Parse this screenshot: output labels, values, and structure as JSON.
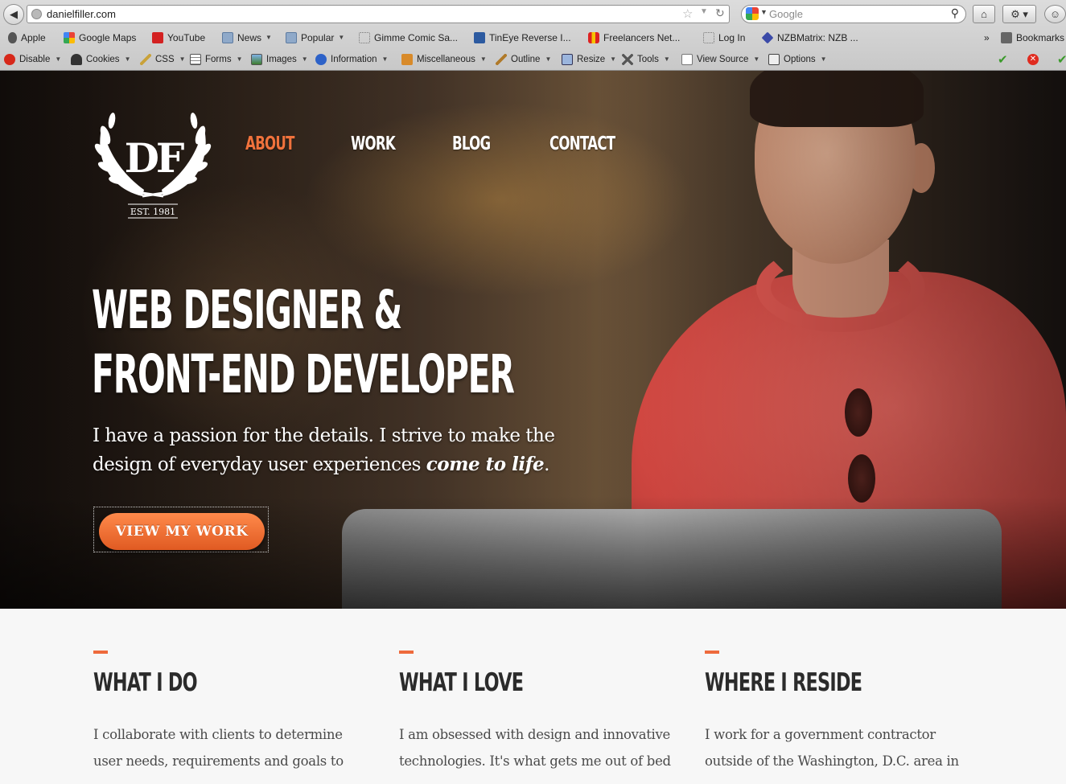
{
  "browser": {
    "url": "danielfiller.com",
    "search_placeholder": "Google",
    "bookmarks": [
      {
        "label": "Apple",
        "icon": "apple-icon"
      },
      {
        "label": "Google Maps",
        "icon": "google-icon"
      },
      {
        "label": "YouTube",
        "icon": "youtube-icon"
      },
      {
        "label": "News",
        "icon": "folder-icon",
        "menu": true
      },
      {
        "label": "Popular",
        "icon": "folder-icon",
        "menu": true
      },
      {
        "label": "Gimme Comic Sa...",
        "icon": "page-icon"
      },
      {
        "label": "TinEye Reverse I...",
        "icon": "tineye-icon"
      },
      {
        "label": "Freelancers Net...",
        "icon": "freelancers-icon"
      },
      {
        "label": "Log In",
        "icon": "page-icon"
      },
      {
        "label": "NZBMatrix: NZB ...",
        "icon": "nzb-icon"
      }
    ],
    "bookmarks_overflow": "»",
    "bookmarks_menu": "Bookmarks",
    "webdev_toolbar": [
      {
        "label": "Disable",
        "icon": "disable-icon"
      },
      {
        "label": "Cookies",
        "icon": "cookies-icon"
      },
      {
        "label": "CSS",
        "icon": "css-icon"
      },
      {
        "label": "Forms",
        "icon": "forms-icon"
      },
      {
        "label": "Images",
        "icon": "images-icon"
      },
      {
        "label": "Information",
        "icon": "information-icon"
      },
      {
        "label": "Miscellaneous",
        "icon": "miscellaneous-icon"
      },
      {
        "label": "Outline",
        "icon": "outline-icon"
      },
      {
        "label": "Resize",
        "icon": "resize-icon"
      },
      {
        "label": "Tools",
        "icon": "tools-icon"
      },
      {
        "label": "View Source",
        "icon": "view-source-icon"
      },
      {
        "label": "Options",
        "icon": "options-icon"
      }
    ]
  },
  "site": {
    "logo": {
      "monogram": "DF",
      "est": "EST. 1981"
    },
    "nav": [
      {
        "label": "ABOUT",
        "active": true
      },
      {
        "label": "WORK",
        "active": false
      },
      {
        "label": "BLOG",
        "active": false
      },
      {
        "label": "CONTACT",
        "active": false
      }
    ],
    "headline_line1": "WEB DESIGNER &",
    "headline_line2": "FRONT-END DEVELOPER",
    "tagline_plain": "I have a passion for the details. I strive to make the design of everyday user experiences ",
    "tagline_emphasis": "come to life",
    "tagline_end": ".",
    "cta_label": "VIEW MY WORK",
    "columns": [
      {
        "title": "WHAT I DO",
        "text": "I collaborate with clients to determine user needs, requirements and goals to"
      },
      {
        "title": "WHAT I LOVE",
        "text": "I am obsessed with design and innovative technologies. It's what gets me out of bed"
      },
      {
        "title": "WHERE I RESIDE",
        "text": "I work for a government contractor outside of the Washington, D.C. area in"
      }
    ]
  },
  "colors": {
    "accent": "#f0723c",
    "button": "#e85f27",
    "shirt": "#e0554e"
  }
}
